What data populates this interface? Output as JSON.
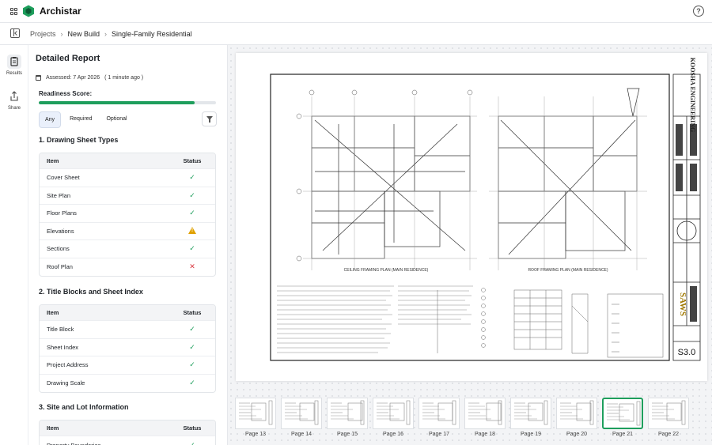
{
  "app": {
    "name": "Archistar"
  },
  "breadcrumb": {
    "items": [
      "Projects",
      "New Build",
      "Single-Family Residential"
    ]
  },
  "rail": {
    "results": "Results",
    "share": "Share"
  },
  "report": {
    "title": "Detailed Report",
    "assessed": "Assessed: 7 Apr 2026",
    "ago": "( 1 minute ago )",
    "readiness_label": "Readiness Score:",
    "readiness_fraction": 0.88,
    "filters": [
      "Any",
      "Required",
      "Optional"
    ],
    "sections": [
      {
        "title": "1. Drawing Sheet Types",
        "head": {
          "item": "Item",
          "status": "Status"
        },
        "rows": [
          {
            "item": "Cover Sheet",
            "status": "pass"
          },
          {
            "item": "Site Plan",
            "status": "pass"
          },
          {
            "item": "Floor Plans",
            "status": "pass"
          },
          {
            "item": "Elevations",
            "status": "warning"
          },
          {
            "item": "Sections",
            "status": "pass"
          },
          {
            "item": "Roof Plan",
            "status": "fail"
          }
        ]
      },
      {
        "title": "2. Title Blocks and Sheet Index",
        "head": {
          "item": "Item",
          "status": "Status"
        },
        "rows": [
          {
            "item": "Title Block",
            "status": "pass"
          },
          {
            "item": "Sheet Index",
            "status": "pass"
          },
          {
            "item": "Project Address",
            "status": "pass"
          },
          {
            "item": "Drawing Scale",
            "status": "pass"
          }
        ]
      },
      {
        "title": "3. Site and Lot Information",
        "head": {
          "item": "Item",
          "status": "Status"
        },
        "rows": [
          {
            "item": "Property Boundaries",
            "status": "pass"
          }
        ]
      }
    ]
  },
  "viewer": {
    "sheet": {
      "left_plan_title": "CEILING FRAMING PLAN (MAIN RESIDENCE)",
      "right_plan_title": "ROOF FRAMING PLAN (MAIN RESIDENCE)",
      "company": "KOOSHA ENGINEERING",
      "logo_text": "SAWS",
      "sheet_number": "S3.0"
    },
    "pages": [
      "Page 13",
      "Page 14",
      "Page 15",
      "Page 16",
      "Page 17",
      "Page 18",
      "Page 19",
      "Page 20",
      "Page 21",
      "Page 22"
    ],
    "active_page": "Page 21"
  },
  "colors": {
    "accent": "#1e9e5c",
    "warning": "#e0a100",
    "fail": "#d9363e"
  }
}
